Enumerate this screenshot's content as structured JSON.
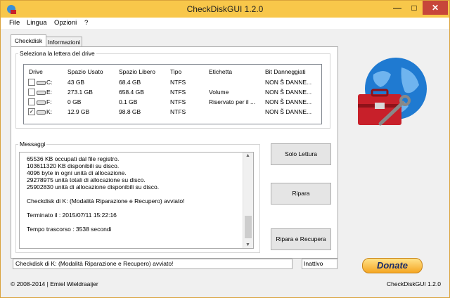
{
  "window": {
    "title": "CheckDiskGUI 1.2.0",
    "close_glyph": "✕",
    "minimize_glyph": "—",
    "maximize_glyph": "□"
  },
  "menu": [
    "File",
    "Lingua",
    "Opzioni",
    "?"
  ],
  "tabs": [
    {
      "label": "Checkdisk",
      "active": true
    },
    {
      "label": "Informazioni",
      "active": false
    }
  ],
  "drive_group": {
    "legend": "Seleziona la lettera del drive",
    "columns": [
      "Drive",
      "Spazio Usato",
      "Spazio Libero",
      "Tipo",
      "Etichetta",
      "Bit Danneggiati"
    ],
    "rows": [
      {
        "checked": false,
        "drive": "C:",
        "used": "43 GB",
        "free": "68.4 GB",
        "type": "NTFS",
        "label": "",
        "bad": "NON Š DANNE..."
      },
      {
        "checked": false,
        "drive": "E:",
        "used": "273.1 GB",
        "free": "658.4 GB",
        "type": "NTFS",
        "label": "Volume",
        "bad": "NON Š DANNE..."
      },
      {
        "checked": false,
        "drive": "F:",
        "used": "0 GB",
        "free": "0.1 GB",
        "type": "NTFS",
        "label": "Riservato per il ...",
        "bad": "NON Š DANNE..."
      },
      {
        "checked": true,
        "drive": "K:",
        "used": "12.9 GB",
        "free": "98.8 GB",
        "type": "NTFS",
        "label": "",
        "bad": "NON Š DANNE..."
      }
    ]
  },
  "messages": {
    "legend": "Messaggi",
    "lines": [
      "65536 KB occupati dal file registro.",
      "103611320 KB disponibili su disco.",
      "4096 byte in ogni unità di allocazione.",
      "29278975 unità totali di allocazione su disco.",
      "25902830 unità di allocazione disponibili su disco.",
      "",
      "Checkdisk di K: (Modalità Riparazione e Recupero) avviato!",
      "",
      "Terminato il : 2015/07/11 15:22:16",
      "",
      "Tempo trascorso : 3538 secondi"
    ],
    "scroll_up": "▲",
    "scroll_down": "▼"
  },
  "buttons": {
    "read_only": "Solo Lettura",
    "repair": "Ripara",
    "repair_recover": "Ripara e Recupera",
    "donate": "Donate"
  },
  "status": {
    "text": "Checkdisk di K: (Modalità Riparazione e Recupero) avviato!",
    "state": "Inattivo"
  },
  "footer": {
    "copyright": "© 2008-2014 | Emiel Wieldraaijer",
    "version": "CheckDiskGUI 1.2.0"
  },
  "colors": {
    "titlebar": "#f8c74a",
    "close": "#c7463a",
    "globe": "#1f7ad1",
    "toolbox": "#c8202a"
  }
}
